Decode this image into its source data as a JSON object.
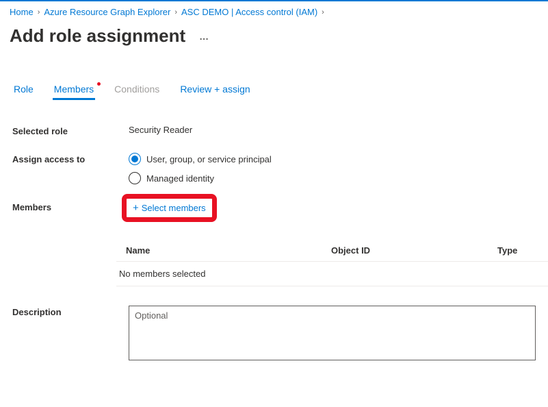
{
  "breadcrumb": {
    "items": [
      {
        "label": "Home"
      },
      {
        "label": "Azure Resource Graph Explorer"
      },
      {
        "label": "ASC DEMO | Access control (IAM)"
      }
    ]
  },
  "page": {
    "title": "Add role assignment"
  },
  "tabs": [
    {
      "label": "Role",
      "state": "link"
    },
    {
      "label": "Members",
      "state": "active",
      "dot": true
    },
    {
      "label": "Conditions",
      "state": "disabled"
    },
    {
      "label": "Review + assign",
      "state": "link"
    }
  ],
  "form": {
    "selected_role_label": "Selected role",
    "selected_role_value": "Security Reader",
    "assign_access_label": "Assign access to",
    "assign_options": [
      {
        "label": "User, group, or service principal",
        "selected": true
      },
      {
        "label": "Managed identity",
        "selected": false
      }
    ],
    "members_label": "Members",
    "select_members_label": "Select members",
    "table": {
      "col_name": "Name",
      "col_objectid": "Object ID",
      "col_type": "Type",
      "empty_text": "No members selected"
    },
    "description_label": "Description",
    "description_placeholder": "Optional"
  }
}
